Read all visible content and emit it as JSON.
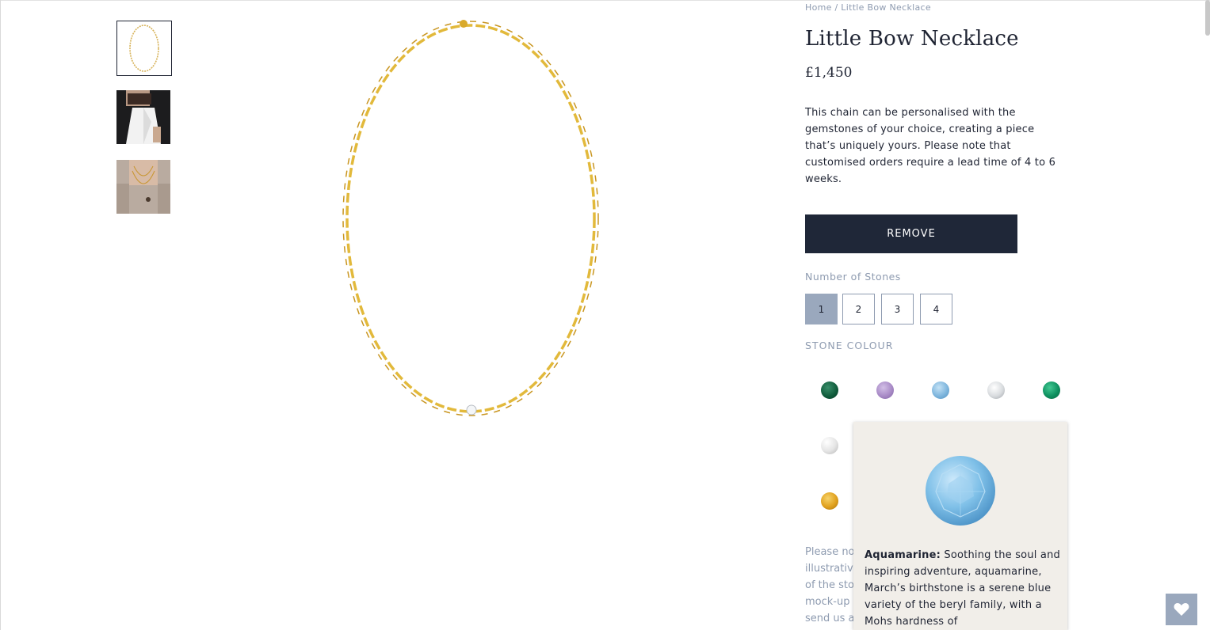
{
  "breadcrumb": {
    "home": "Home",
    "separator": "/",
    "current": "Little Bow Necklace"
  },
  "product": {
    "title": "Little Bow Necklace",
    "price": "£1,450",
    "description": "This chain can be personalised with the gemstones of your choice, creating a piece that’s uniquely yours. Please note that customised orders require a lead time of 4 to 6 weeks."
  },
  "actions": {
    "remove_label": "REMOVE"
  },
  "stones": {
    "label": "Number of Stones",
    "options": [
      "1",
      "2",
      "3",
      "4"
    ],
    "selected": "1"
  },
  "stone_colour": {
    "label": "STONE COLOUR",
    "swatches": [
      {
        "name": "emerald-dark",
        "color": "#0f5a3a"
      },
      {
        "name": "amethyst",
        "color": "#a98bc7"
      },
      {
        "name": "aquamarine",
        "color": "#7fb6dd"
      },
      {
        "name": "diamond",
        "color": "#e5e7ea"
      },
      {
        "name": "emerald",
        "color": "#0e9160"
      },
      {
        "name": "pearl",
        "color": "#e4e4e4"
      },
      {
        "name": "citrine",
        "color": "#e0a11e"
      }
    ]
  },
  "note_fragment": [
    "Please no",
    "illustrativ",
    "of the sto",
    "mock-up",
    "send us a"
  ],
  "tooltip": {
    "gem_name": "Aquamarine:",
    "gem_color": "#7fc0e8",
    "text": " Soothing the soul and inspiring adventure, aquamarine, March’s birthstone is a serene blue variety of the beryl family, with a Mohs hardness of"
  },
  "accent_color": "#1f2738",
  "muted_color": "#8e9bb0"
}
